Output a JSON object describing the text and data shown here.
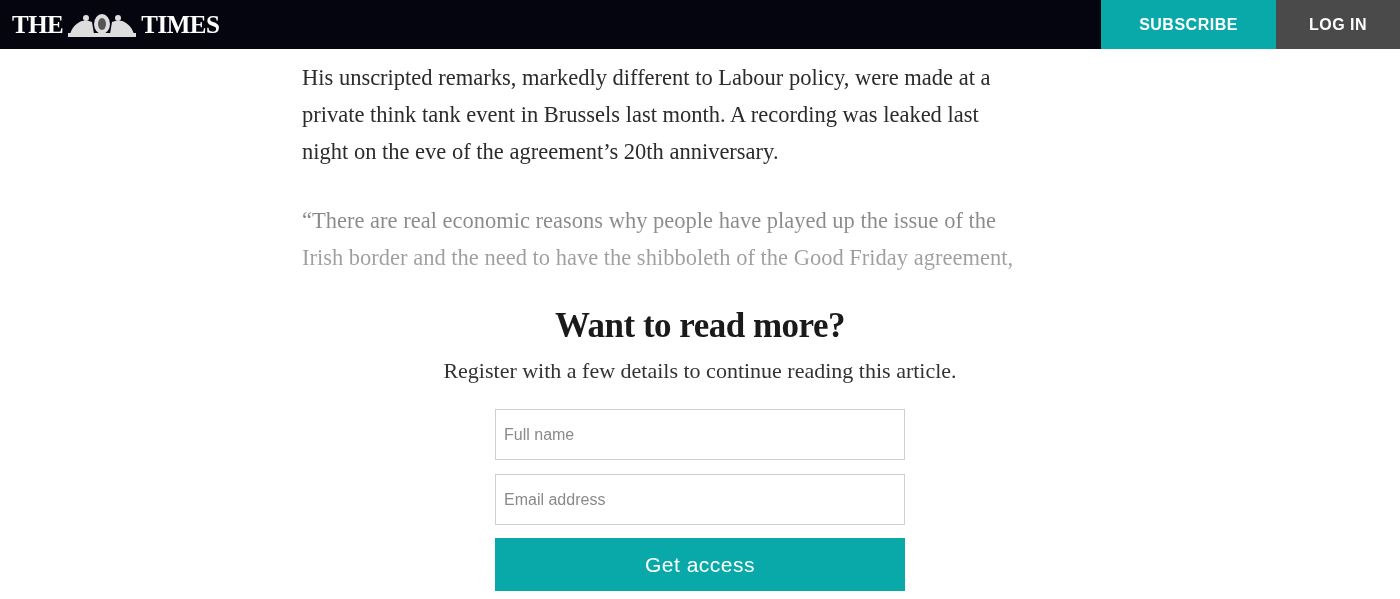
{
  "header": {
    "logo": {
      "left": "THE",
      "right": "TIMES"
    },
    "buttons": [
      {
        "label": "SUBSCRIBE",
        "kind": "primary"
      },
      {
        "label": "LOG IN",
        "kind": "secondary"
      }
    ]
  },
  "article": {
    "paragraphs": [
      {
        "lines": [
          "His unscripted remarks, markedly different to Labour policy, were made at a",
          "private think tank event in Brussels last month. A recording was leaked last",
          "night on the eve of the agreement’s 20th anniversary."
        ],
        "faded": false
      },
      {
        "lines": [
          "“There are real economic reasons why people have played up the issue of the",
          "Irish border and the need to have the shibboleth of the Good Friday agreement,"
        ],
        "faded": true
      }
    ]
  },
  "paywall": {
    "title": "Want to read more?",
    "subtitle": "Register with a few details to continue reading this article.",
    "fields": [
      {
        "placeholder": "Full name"
      },
      {
        "placeholder": "Email address"
      }
    ],
    "button": "Get access"
  }
}
